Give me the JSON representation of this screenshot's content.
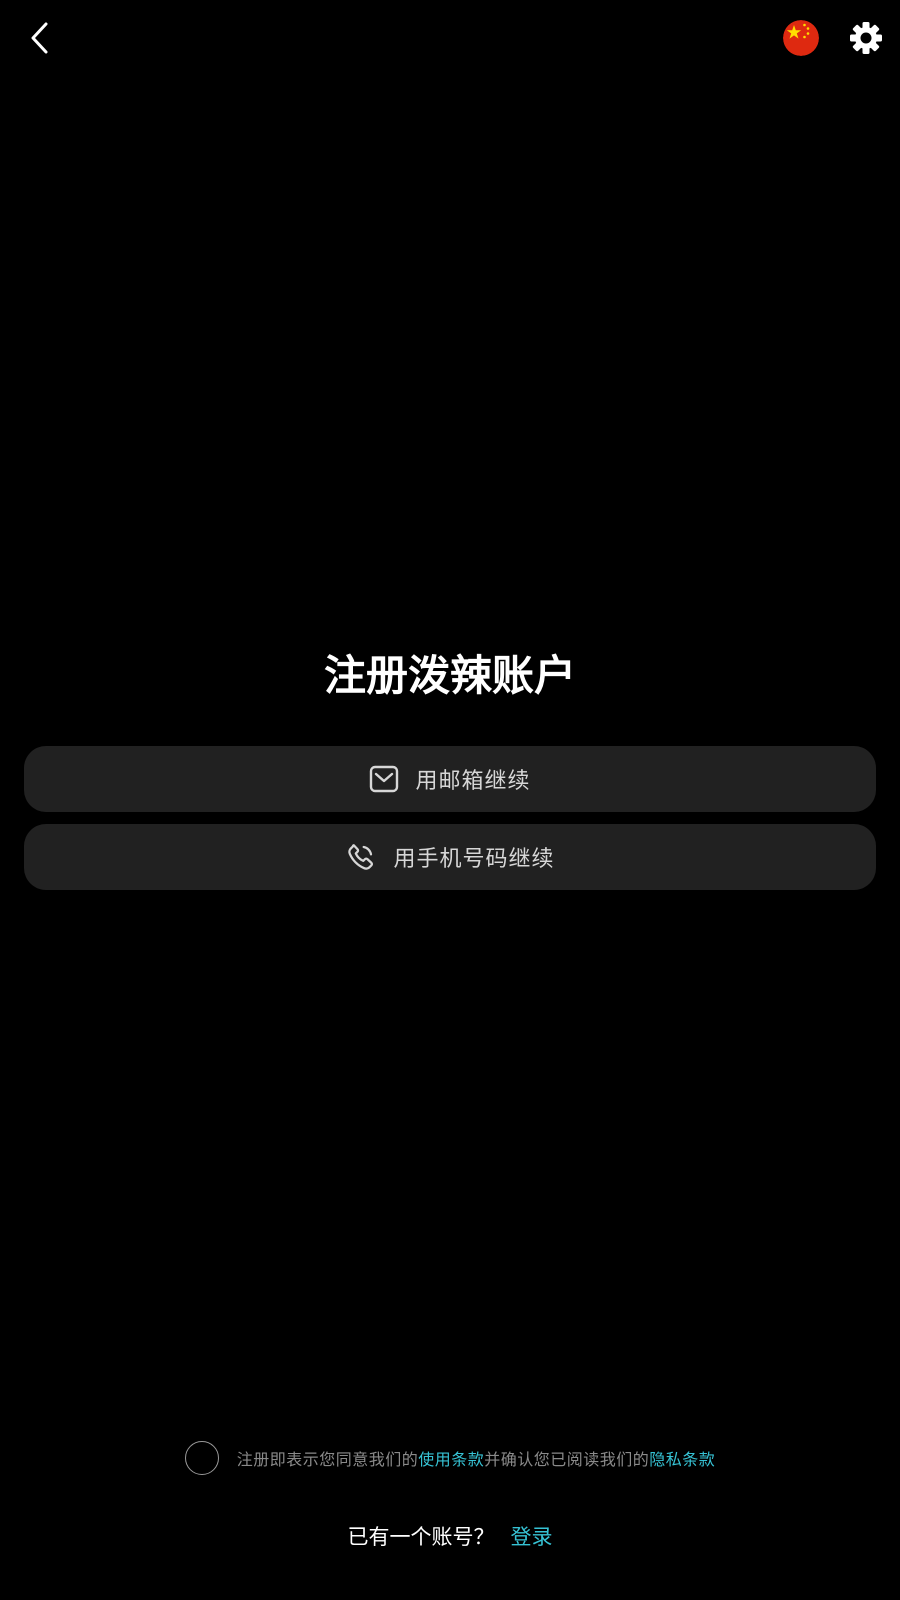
{
  "header": {
    "back_icon": "chevron-left-icon",
    "region_flag_icon": "china-flag-icon",
    "settings_icon": "gear-icon"
  },
  "title": "注册泼辣账户",
  "options": {
    "email": {
      "icon": "mail-icon",
      "label": "用邮箱继续"
    },
    "phone": {
      "icon": "phone-icon",
      "label": "用手机号码继续"
    }
  },
  "agreement": {
    "text_before": "注册即表示您同意我们的",
    "terms_link": "使用条款",
    "text_middle": "并确认您已阅读我们的",
    "privacy_link": "隐私条款"
  },
  "login": {
    "prompt": "已有一个账号？",
    "link": "登录"
  },
  "colors": {
    "background": "#000000",
    "button_bg": "#212121",
    "accent": "#36c2d4",
    "flag_red": "#de2910",
    "flag_yellow": "#ffde00"
  }
}
